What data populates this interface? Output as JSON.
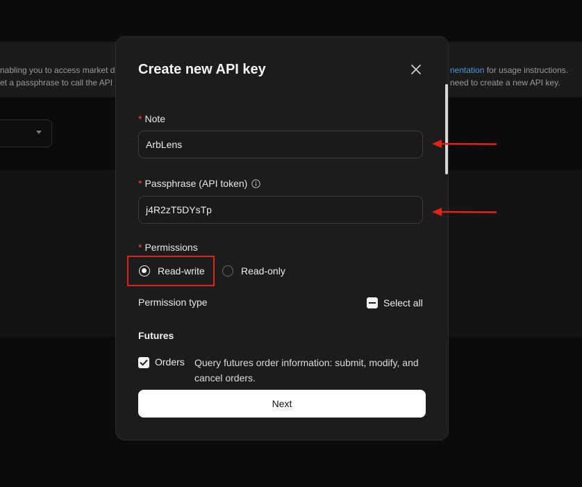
{
  "background": {
    "banner_line1_prefix": "nabling you to access market d",
    "banner_line1_link": "nentation",
    "banner_line1_suffix": " for usage instructions.",
    "banner_line2_prefix": "et a passphrase to call the API",
    "banner_line2_suffix": "need to create a new API key."
  },
  "modal": {
    "title": "Create new API key",
    "note_label": "Note",
    "note_value": "ArbLens",
    "passphrase_label": "Passphrase (API token)",
    "passphrase_value": "j4R2zT5DYsTp",
    "permissions_label": "Permissions",
    "required_mark": "*",
    "radio_options": [
      {
        "label": "Read-write",
        "selected": true
      },
      {
        "label": "Read-only",
        "selected": false
      }
    ],
    "permission_type_label": "Permission type",
    "select_all_label": "Select all",
    "futures_title": "Futures",
    "orders_label": "Orders",
    "orders_checked": true,
    "orders_description": "Query futures order information: submit, modify, and cancel orders.",
    "next_label": "Next"
  },
  "colors": {
    "required": "#f0494e",
    "annotation": "#e2231a",
    "link": "#3f9bd8"
  },
  "icons": [
    "close-icon",
    "info-icon",
    "checkbox-indeterminate-icon",
    "checkmark-icon",
    "chevron-down-icon",
    "arrow-left-icon"
  ]
}
